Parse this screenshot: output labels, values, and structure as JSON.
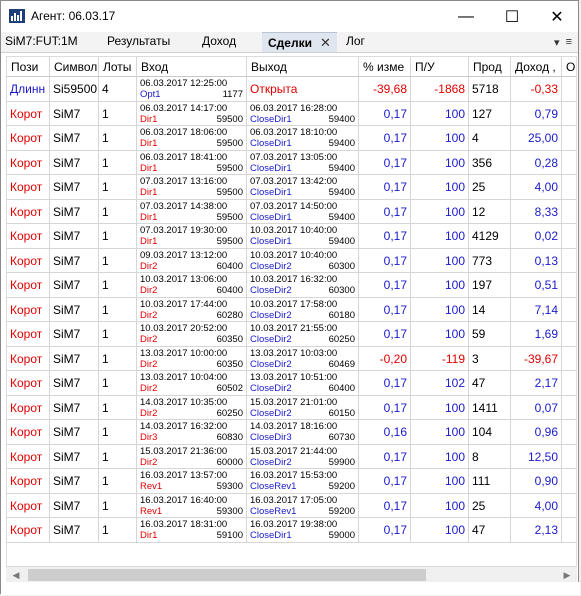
{
  "window": {
    "title": "Агент: 06.03.17",
    "minimize": "—",
    "maximize": "☐",
    "close": "✕"
  },
  "tabs": {
    "symbol": "SiM7:FUT:1M",
    "results": "Результаты",
    "income": "Доход",
    "deals": "Сделки",
    "deals_close": "✕",
    "log": "Лог",
    "menu_icon": "▾",
    "list_icon": "≡"
  },
  "table": {
    "headers": [
      "Пози",
      "Символ",
      "Лоты",
      "Вход",
      "Выход",
      "% изме",
      "П/У",
      "Прод",
      "Доход ,",
      "Об"
    ],
    "rows": [
      {
        "pos": "Длинн",
        "pos_color": "blue",
        "sym": "Si59500",
        "lots": "4",
        "in_date": "06.03.2017 12:25:00",
        "in_name": "Opt1",
        "in_price": "1177",
        "in_name_color": "blue",
        "out_single": "Открыта",
        "out_date": "",
        "out_name": "",
        "out_price": "",
        "pct": "-39,68",
        "pct_color": "red",
        "pl": "-1868",
        "pl_color": "red",
        "dur": "5718",
        "inc": "-0,33",
        "inc_color": "red"
      },
      {
        "pos": "Корот",
        "pos_color": "red",
        "sym": "SiM7",
        "lots": "1",
        "in_date": "06.03.2017 14:17:00",
        "in_name": "Dir1",
        "in_price": "59500",
        "in_name_color": "red",
        "out_single": "",
        "out_date": "06.03.2017 16:28:00",
        "out_name": "CloseDir1",
        "out_price": "59400",
        "pct": "0,17",
        "pct_color": "blue",
        "pl": "100",
        "pl_color": "blue",
        "dur": "127",
        "inc": "0,79",
        "inc_color": "blue"
      },
      {
        "pos": "Корот",
        "pos_color": "red",
        "sym": "SiM7",
        "lots": "1",
        "in_date": "06.03.2017 18:06:00",
        "in_name": "Dir1",
        "in_price": "59500",
        "in_name_color": "red",
        "out_single": "",
        "out_date": "06.03.2017 18:10:00",
        "out_name": "CloseDir1",
        "out_price": "59400",
        "pct": "0,17",
        "pct_color": "blue",
        "pl": "100",
        "pl_color": "blue",
        "dur": "4",
        "inc": "25,00",
        "inc_color": "blue"
      },
      {
        "pos": "Корот",
        "pos_color": "red",
        "sym": "SiM7",
        "lots": "1",
        "in_date": "06.03.2017 18:41:00",
        "in_name": "Dir1",
        "in_price": "59500",
        "in_name_color": "red",
        "out_single": "",
        "out_date": "07.03.2017 13:05:00",
        "out_name": "CloseDir1",
        "out_price": "59400",
        "pct": "0,17",
        "pct_color": "blue",
        "pl": "100",
        "pl_color": "blue",
        "dur": "356",
        "inc": "0,28",
        "inc_color": "blue"
      },
      {
        "pos": "Корот",
        "pos_color": "red",
        "sym": "SiM7",
        "lots": "1",
        "in_date": "07.03.2017 13:16:00",
        "in_name": "Dir1",
        "in_price": "59500",
        "in_name_color": "red",
        "out_single": "",
        "out_date": "07.03.2017 13:42:00",
        "out_name": "CloseDir1",
        "out_price": "59400",
        "pct": "0,17",
        "pct_color": "blue",
        "pl": "100",
        "pl_color": "blue",
        "dur": "25",
        "inc": "4,00",
        "inc_color": "blue"
      },
      {
        "pos": "Корот",
        "pos_color": "red",
        "sym": "SiM7",
        "lots": "1",
        "in_date": "07.03.2017 14:38:00",
        "in_name": "Dir1",
        "in_price": "59500",
        "in_name_color": "red",
        "out_single": "",
        "out_date": "07.03.2017 14:50:00",
        "out_name": "CloseDir1",
        "out_price": "59400",
        "pct": "0,17",
        "pct_color": "blue",
        "pl": "100",
        "pl_color": "blue",
        "dur": "12",
        "inc": "8,33",
        "inc_color": "blue"
      },
      {
        "pos": "Корот",
        "pos_color": "red",
        "sym": "SiM7",
        "lots": "1",
        "in_date": "07.03.2017 19:30:00",
        "in_name": "Dir1",
        "in_price": "59500",
        "in_name_color": "red",
        "out_single": "",
        "out_date": "10.03.2017 10:40:00",
        "out_name": "CloseDir1",
        "out_price": "59400",
        "pct": "0,17",
        "pct_color": "blue",
        "pl": "100",
        "pl_color": "blue",
        "dur": "4129",
        "inc": "0,02",
        "inc_color": "blue"
      },
      {
        "pos": "Корот",
        "pos_color": "red",
        "sym": "SiM7",
        "lots": "1",
        "in_date": "09.03.2017 13:12:00",
        "in_name": "Dir2",
        "in_price": "60400",
        "in_name_color": "red",
        "out_single": "",
        "out_date": "10.03.2017 10:40:00",
        "out_name": "CloseDir2",
        "out_price": "60300",
        "pct": "0,17",
        "pct_color": "blue",
        "pl": "100",
        "pl_color": "blue",
        "dur": "773",
        "inc": "0,13",
        "inc_color": "blue"
      },
      {
        "pos": "Корот",
        "pos_color": "red",
        "sym": "SiM7",
        "lots": "1",
        "in_date": "10.03.2017 13:06:00",
        "in_name": "Dir2",
        "in_price": "60400",
        "in_name_color": "red",
        "out_single": "",
        "out_date": "10.03.2017 16:32:00",
        "out_name": "CloseDir2",
        "out_price": "60300",
        "pct": "0,17",
        "pct_color": "blue",
        "pl": "100",
        "pl_color": "blue",
        "dur": "197",
        "inc": "0,51",
        "inc_color": "blue"
      },
      {
        "pos": "Корот",
        "pos_color": "red",
        "sym": "SiM7",
        "lots": "1",
        "in_date": "10.03.2017 17:44:00",
        "in_name": "Dir2",
        "in_price": "60280",
        "in_name_color": "red",
        "out_single": "",
        "out_date": "10.03.2017 17:58:00",
        "out_name": "CloseDir2",
        "out_price": "60180",
        "pct": "0,17",
        "pct_color": "blue",
        "pl": "100",
        "pl_color": "blue",
        "dur": "14",
        "inc": "7,14",
        "inc_color": "blue"
      },
      {
        "pos": "Корот",
        "pos_color": "red",
        "sym": "SiM7",
        "lots": "1",
        "in_date": "10.03.2017 20:52:00",
        "in_name": "Dir2",
        "in_price": "60350",
        "in_name_color": "red",
        "out_single": "",
        "out_date": "10.03.2017 21:55:00",
        "out_name": "CloseDir2",
        "out_price": "60250",
        "pct": "0,17",
        "pct_color": "blue",
        "pl": "100",
        "pl_color": "blue",
        "dur": "59",
        "inc": "1,69",
        "inc_color": "blue"
      },
      {
        "pos": "Корот",
        "pos_color": "red",
        "sym": "SiM7",
        "lots": "1",
        "in_date": "13.03.2017 10:00:00",
        "in_name": "Dir2",
        "in_price": "60350",
        "in_name_color": "red",
        "out_single": "",
        "out_date": "13.03.2017 10:03:00",
        "out_name": "CloseDir2",
        "out_price": "60469",
        "pct": "-0,20",
        "pct_color": "red",
        "pl": "-119",
        "pl_color": "red",
        "dur": "3",
        "inc": "-39,67",
        "inc_color": "red"
      },
      {
        "pos": "Корот",
        "pos_color": "red",
        "sym": "SiM7",
        "lots": "1",
        "in_date": "13.03.2017 10:04:00",
        "in_name": "Dir2",
        "in_price": "60502",
        "in_name_color": "red",
        "out_single": "",
        "out_date": "13.03.2017 10:51:00",
        "out_name": "CloseDir2",
        "out_price": "60400",
        "pct": "0,17",
        "pct_color": "blue",
        "pl": "102",
        "pl_color": "blue",
        "dur": "47",
        "inc": "2,17",
        "inc_color": "blue"
      },
      {
        "pos": "Корот",
        "pos_color": "red",
        "sym": "SiM7",
        "lots": "1",
        "in_date": "14.03.2017 10:35:00",
        "in_name": "Dir2",
        "in_price": "60250",
        "in_name_color": "red",
        "out_single": "",
        "out_date": "15.03.2017 21:01:00",
        "out_name": "CloseDir2",
        "out_price": "60150",
        "pct": "0,17",
        "pct_color": "blue",
        "pl": "100",
        "pl_color": "blue",
        "dur": "1411",
        "inc": "0,07",
        "inc_color": "blue"
      },
      {
        "pos": "Корот",
        "pos_color": "red",
        "sym": "SiM7",
        "lots": "1",
        "in_date": "14.03.2017 16:32:00",
        "in_name": "Dir3",
        "in_price": "60830",
        "in_name_color": "red",
        "out_single": "",
        "out_date": "14.03.2017 18:16:00",
        "out_name": "CloseDir3",
        "out_price": "60730",
        "pct": "0,16",
        "pct_color": "blue",
        "pl": "100",
        "pl_color": "blue",
        "dur": "104",
        "inc": "0,96",
        "inc_color": "blue"
      },
      {
        "pos": "Корот",
        "pos_color": "red",
        "sym": "SiM7",
        "lots": "1",
        "in_date": "15.03.2017 21:36:00",
        "in_name": "Dir2",
        "in_price": "60000",
        "in_name_color": "red",
        "out_single": "",
        "out_date": "15.03.2017 21:44:00",
        "out_name": "CloseDir2",
        "out_price": "59900",
        "pct": "0,17",
        "pct_color": "blue",
        "pl": "100",
        "pl_color": "blue",
        "dur": "8",
        "inc": "12,50",
        "inc_color": "blue"
      },
      {
        "pos": "Корот",
        "pos_color": "red",
        "sym": "SiM7",
        "lots": "1",
        "in_date": "16.03.2017 13:57:00",
        "in_name": "Rev1",
        "in_price": "59300",
        "in_name_color": "red",
        "out_single": "",
        "out_date": "16.03.2017 15:53:00",
        "out_name": "CloseRev1",
        "out_price": "59200",
        "pct": "0,17",
        "pct_color": "blue",
        "pl": "100",
        "pl_color": "blue",
        "dur": "111",
        "inc": "0,90",
        "inc_color": "blue"
      },
      {
        "pos": "Корот",
        "pos_color": "red",
        "sym": "SiM7",
        "lots": "1",
        "in_date": "16.03.2017 16:40:00",
        "in_name": "Rev1",
        "in_price": "59300",
        "in_name_color": "red",
        "out_single": "",
        "out_date": "16.03.2017 17:05:00",
        "out_name": "CloseRev1",
        "out_price": "59200",
        "pct": "0,17",
        "pct_color": "blue",
        "pl": "100",
        "pl_color": "blue",
        "dur": "25",
        "inc": "4,00",
        "inc_color": "blue"
      },
      {
        "pos": "Корот",
        "pos_color": "red",
        "sym": "SiM7",
        "lots": "1",
        "in_date": "16.03.2017 18:31:00",
        "in_name": "Dir1",
        "in_price": "59100",
        "in_name_color": "red",
        "out_single": "",
        "out_date": "16.03.2017 19:38:00",
        "out_name": "CloseDir1",
        "out_price": "59000",
        "pct": "0,17",
        "pct_color": "blue",
        "pl": "100",
        "pl_color": "blue",
        "dur": "47",
        "inc": "2,13",
        "inc_color": "blue"
      }
    ]
  },
  "scrollbar": {
    "left_arrow": "◀",
    "right_arrow": "▶"
  }
}
